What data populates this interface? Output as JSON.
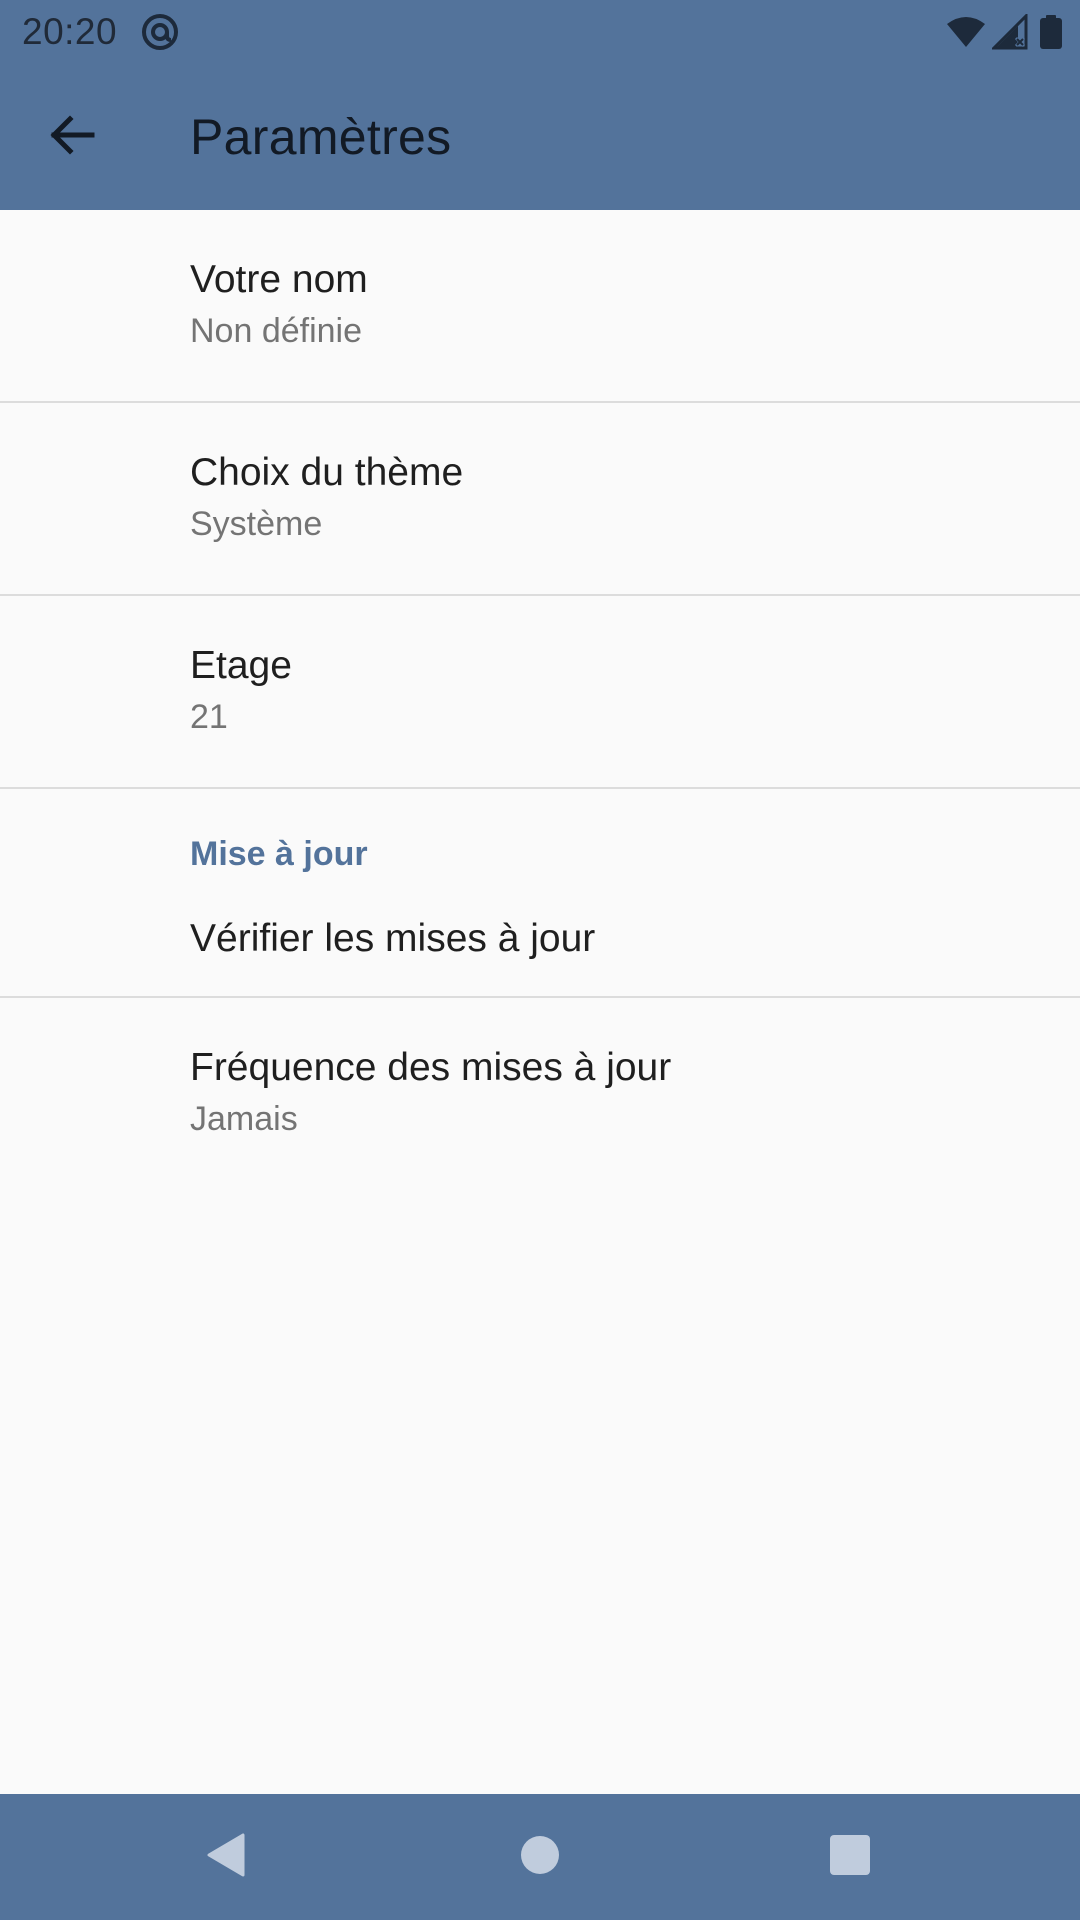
{
  "status_bar": {
    "time": "20:20",
    "icons": [
      "at-sign-icon",
      "wifi-icon",
      "signal-icon",
      "battery-icon"
    ]
  },
  "app_bar": {
    "title": "Paramètres",
    "back_icon": "arrow-back-icon"
  },
  "preferences": {
    "name": {
      "title": "Votre nom",
      "summary": "Non définie"
    },
    "theme": {
      "title": "Choix du thème",
      "summary": "Système"
    },
    "floor": {
      "title": "Etage",
      "summary": "21"
    },
    "updates_category": {
      "title": "Mise à jour"
    },
    "check_updates": {
      "title": "Vérifier les mises à jour"
    },
    "update_frequency": {
      "title": "Fréquence des mises à jour",
      "summary": "Jamais"
    }
  },
  "nav_bar": {
    "icons": [
      "nav-back-icon",
      "nav-home-icon",
      "nav-recents-icon"
    ]
  },
  "colors": {
    "primary": "#53739b",
    "background": "#fafafa",
    "accent_text": "#53739b",
    "title_text": "#1f1f1f",
    "summary_text": "#747474",
    "divider": "#dcdcdc"
  }
}
